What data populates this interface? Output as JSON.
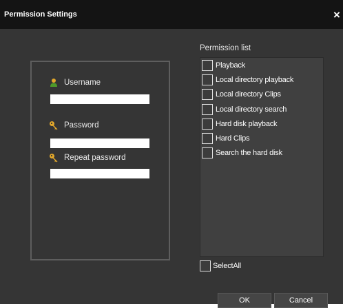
{
  "window": {
    "title": "Permission Settings",
    "close_symbol": "×"
  },
  "credentials": {
    "username_label": "Username",
    "username_value": "",
    "password_label": "Password",
    "password_value": "",
    "repeat_password_label": "Repeat password",
    "repeat_password_value": "",
    "username_icon": "user-icon",
    "password_icon": "key-icon"
  },
  "permissions": {
    "title": "Permission list",
    "items": [
      {
        "label": "Playback",
        "checked": false
      },
      {
        "label": "Local directory playback",
        "checked": false
      },
      {
        "label": "Local directory Clips",
        "checked": false
      },
      {
        "label": "Local directory search",
        "checked": false
      },
      {
        "label": "Hard disk playback",
        "checked": false
      },
      {
        "label": "Hard Clips",
        "checked": false
      },
      {
        "label": "Search the hard disk",
        "checked": false
      }
    ],
    "select_all_label": "SelectAll"
  },
  "footer": {
    "ok_label": "OK",
    "cancel_label": "Cancel"
  },
  "colors": {
    "window_bg": "#353535",
    "titlebar_bg": "#141414",
    "list_bg": "#404040",
    "icon_gold": "#e3a82b",
    "icon_green": "#4f9a2a"
  }
}
